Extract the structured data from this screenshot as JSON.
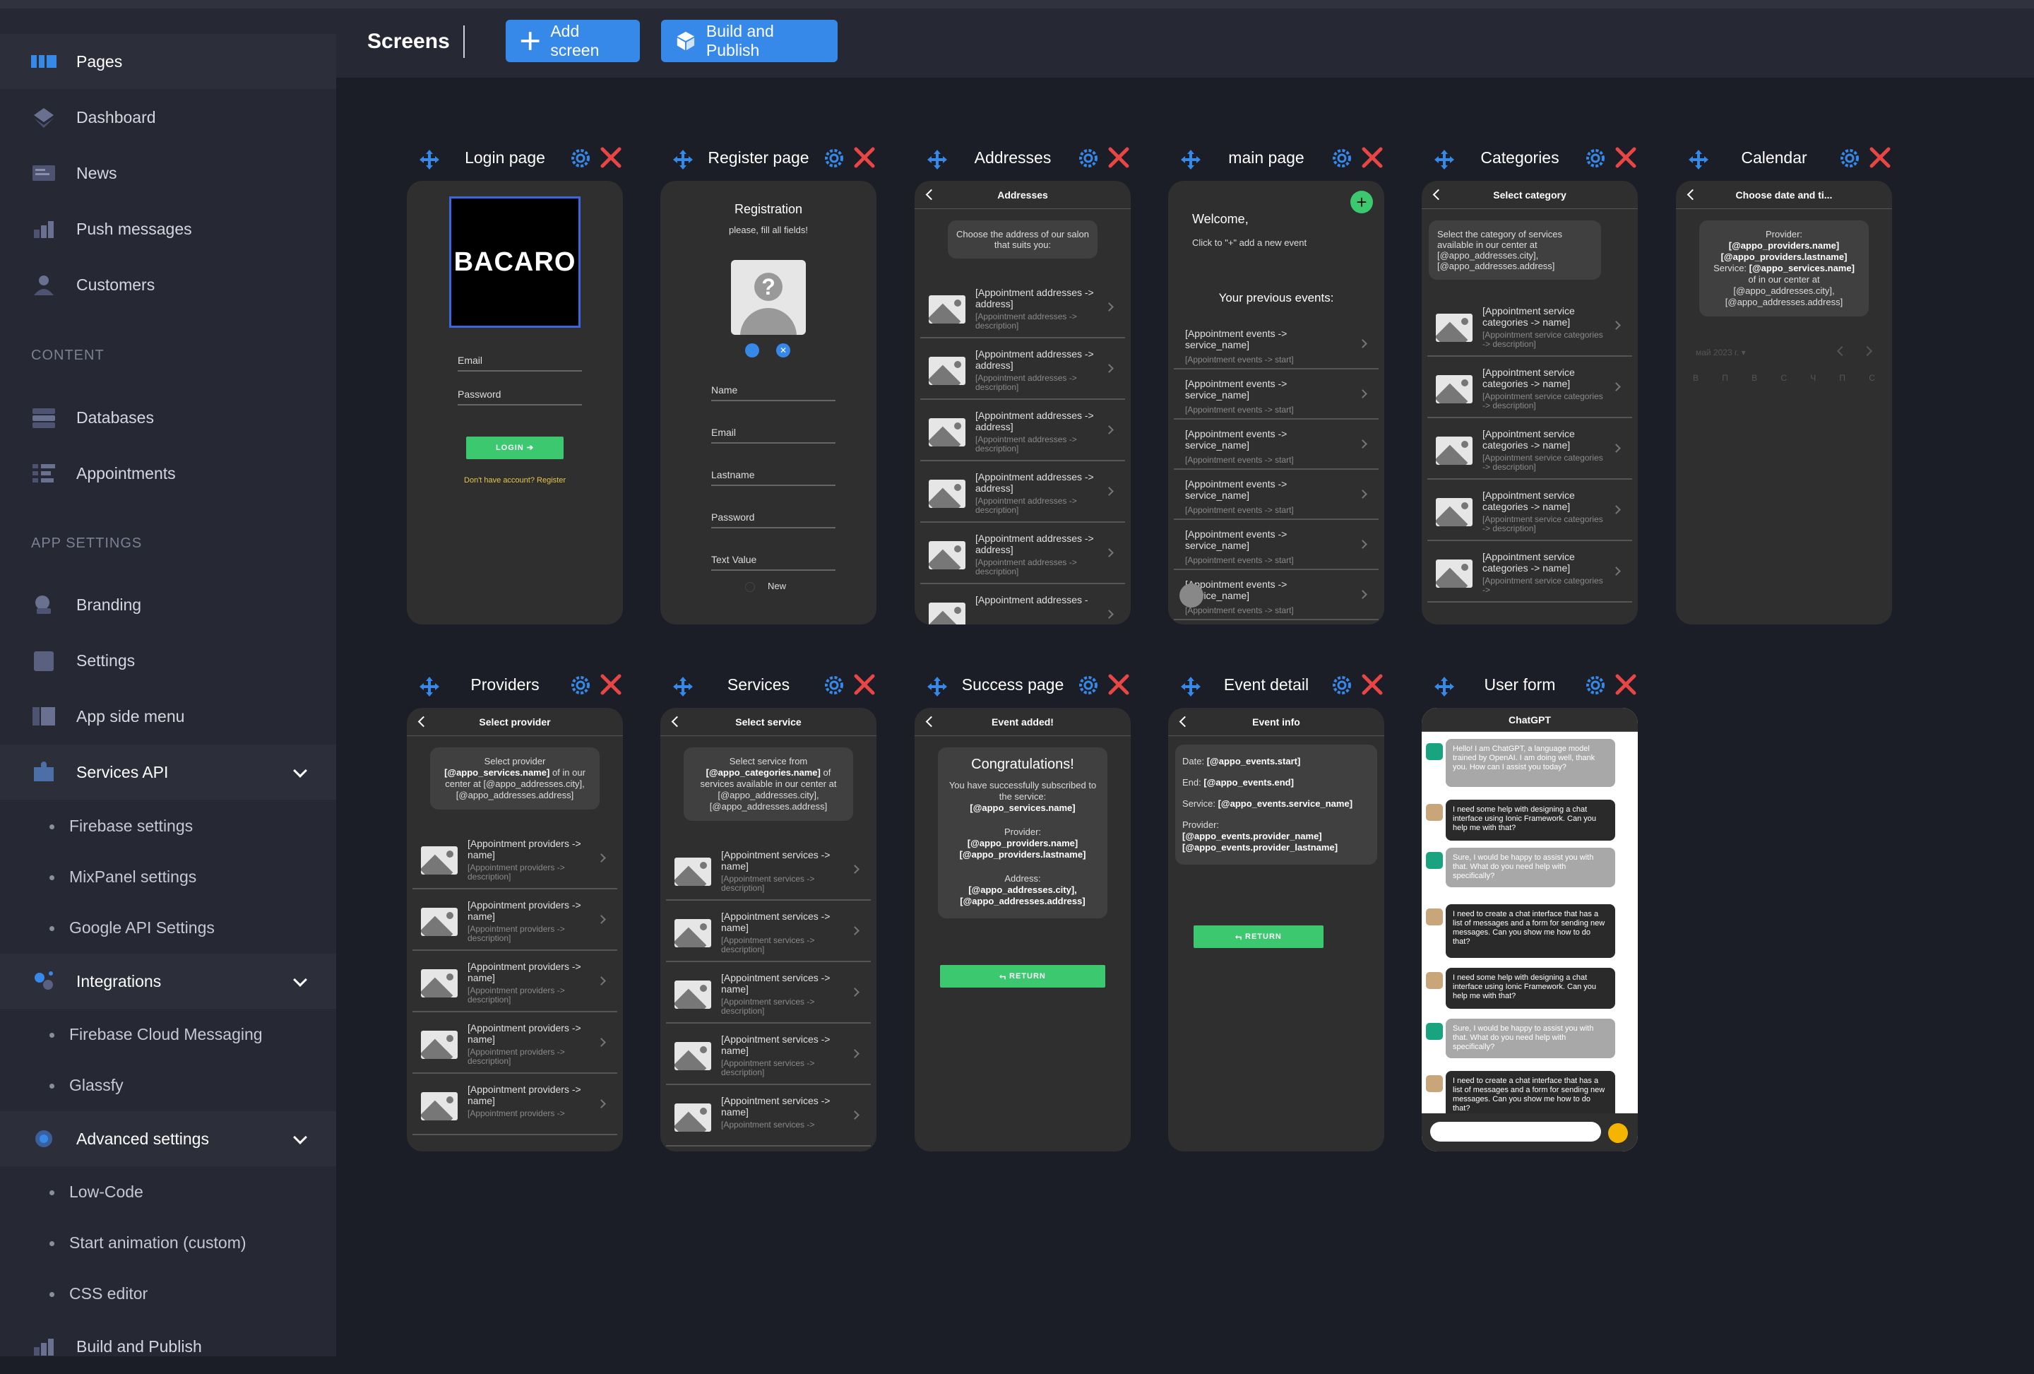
{
  "sidebar": {
    "items": [
      {
        "label": "Pages"
      },
      {
        "label": "Dashboard"
      },
      {
        "label": "News"
      },
      {
        "label": "Push messages"
      },
      {
        "label": "Customers"
      },
      {
        "label": "Databases"
      },
      {
        "label": "Appointments"
      },
      {
        "label": "Branding"
      },
      {
        "label": "Settings"
      },
      {
        "label": "App side menu"
      },
      {
        "label": "Services API"
      },
      {
        "label": "Integrations"
      },
      {
        "label": "Advanced settings"
      },
      {
        "label": "Build and Publish"
      }
    ],
    "sections": [
      "CONTENT",
      "APP SETTINGS"
    ],
    "services_sub": [
      "Firebase settings",
      "MixPanel settings",
      "Google API Settings"
    ],
    "integrations_sub": [
      "Firebase Cloud Messaging",
      "Glassfy"
    ],
    "advanced_sub": [
      "Low-Code",
      "Start animation (custom)",
      "CSS editor"
    ]
  },
  "header": {
    "title": "Screens",
    "add_label": "Add screen",
    "build_label": "Build and Publish"
  },
  "colors": {
    "accent": "#3689e8",
    "close": "#e84545",
    "green": "#3cc86f"
  },
  "cards": [
    {
      "name": "Login page"
    },
    {
      "name": "Register page"
    },
    {
      "name": "Addresses"
    },
    {
      "name": "main page"
    },
    {
      "name": "Categories"
    },
    {
      "name": "Calendar"
    },
    {
      "name": "Providers"
    },
    {
      "name": "Services"
    },
    {
      "name": "Success page"
    },
    {
      "name": "Event detail"
    },
    {
      "name": "User form"
    }
  ],
  "login": {
    "logo": "BACARO",
    "email": "Email",
    "password": "Password",
    "button": "LOGIN",
    "register": "Don't have account? Register"
  },
  "register": {
    "title": "Registration",
    "subtitle": "please, fill all fields!",
    "fields": [
      "Name",
      "Email",
      "Lastname",
      "Password",
      "Text Value"
    ],
    "new_label": "New"
  },
  "addresses": {
    "nav": "Addresses",
    "intro": "Choose the address of our salon that suits you:",
    "row_title": "[Appointment addresses -> address]",
    "row_sub": "[Appointment addresses -> description]",
    "last_title": "[Appointment addresses -"
  },
  "main": {
    "welcome": "Welcome,",
    "hint": "Click to \"+\" add a new event",
    "prev": "Your previous events:",
    "row_title": "[Appointment events -> service_name]",
    "row_sub": "[Appointment events -> start]",
    "last_title": "[Appointment events -> service_name]"
  },
  "categories": {
    "nav": "Select category",
    "intro": "Select the category of services available in our center at [@appo_addresses.city], [@appo_addresses.address]",
    "row_title": "[Appointment service categories -> name]",
    "row_sub": "[Appointment service categories -> description]",
    "last_sub": "[Appointment service categories ->"
  },
  "calendar": {
    "nav": "Choose date and ti...",
    "provider_label": "Provider:",
    "provider_value": "[@appo_providers.name] [@appo_providers.lastname]",
    "service_label": "Service:",
    "service_value": "[@appo_services.name]",
    "location": "of  in our center at [@appo_addresses.city], [@appo_addresses.address]",
    "month": "май 2023 г.",
    "weekdays": [
      "В",
      "П",
      "В",
      "С",
      "Ч",
      "П",
      "С"
    ]
  },
  "providers": {
    "nav": "Select provider",
    "intro_a": "Select provider",
    "intro_bold": "[@appo_services.name]",
    "intro_b": "of in our center at [@appo_addresses.city], [@appo_addresses.address]",
    "row_title": "[Appointment providers -> name]",
    "row_sub": "[Appointment providers -> description]",
    "last_sub": "[Appointment providers ->"
  },
  "services": {
    "nav": "Select service",
    "intro_a": "Select service from",
    "intro_bold": "[@appo_categories.name]",
    "intro_b": "of services available in our center at [@appo_addresses.city], [@appo_addresses.address]",
    "row_title": "[Appointment services -> name]",
    "row_sub": "[Appointment services -> description]",
    "last_sub": "[Appointment services ->"
  },
  "success": {
    "nav": "Event added!",
    "title": "Congratulations!",
    "subscribed": "You have successfully subscribed to the service:",
    "service": "[@appo_services.name]",
    "provider_label": "Provider:",
    "provider": "[@appo_providers.name] [@appo_providers.lastname]",
    "address_label": "Address:",
    "address": "[@appo_addresses.city], [@appo_addresses.address]",
    "button": "RETURN"
  },
  "event": {
    "nav": "Event info",
    "date_label": "Date:",
    "date": "[@appo_events.start]",
    "end_label": "End:",
    "end": "[@appo_events.end]",
    "service_label": "Service:",
    "service": "[@appo_events.service_name]",
    "provider_label": "Provider:",
    "provider": "[@appo_events.provider_name] [@appo_events.provider_lastname]",
    "button": "RETURN"
  },
  "userform": {
    "nav": "ChatGPT",
    "messages": [
      {
        "from": "bot",
        "text": "Hello! I am ChatGPT, a language model trained by OpenAI. I am doing well, thank you. How can I assist you today?"
      },
      {
        "from": "user",
        "text": "I need some help with designing a chat interface using Ionic Framework. Can you help me with that?"
      },
      {
        "from": "bot",
        "text": "Sure, I would be happy to assist you with that. What do you need help with specifically?"
      },
      {
        "from": "user",
        "text": "I need to create a chat interface that has a list of messages and a form for sending new messages. Can you show me how to do that?"
      },
      {
        "from": "user",
        "text": "I need some help with designing a chat interface using Ionic Framework. Can you help me with that?"
      },
      {
        "from": "bot",
        "text": "Sure, I would be happy to assist you with that. What do you need help with specifically?"
      },
      {
        "from": "user",
        "text": "I need to create a chat interface that has a list of messages and a form for sending new messages. Can you show me how to do that?"
      }
    ]
  }
}
